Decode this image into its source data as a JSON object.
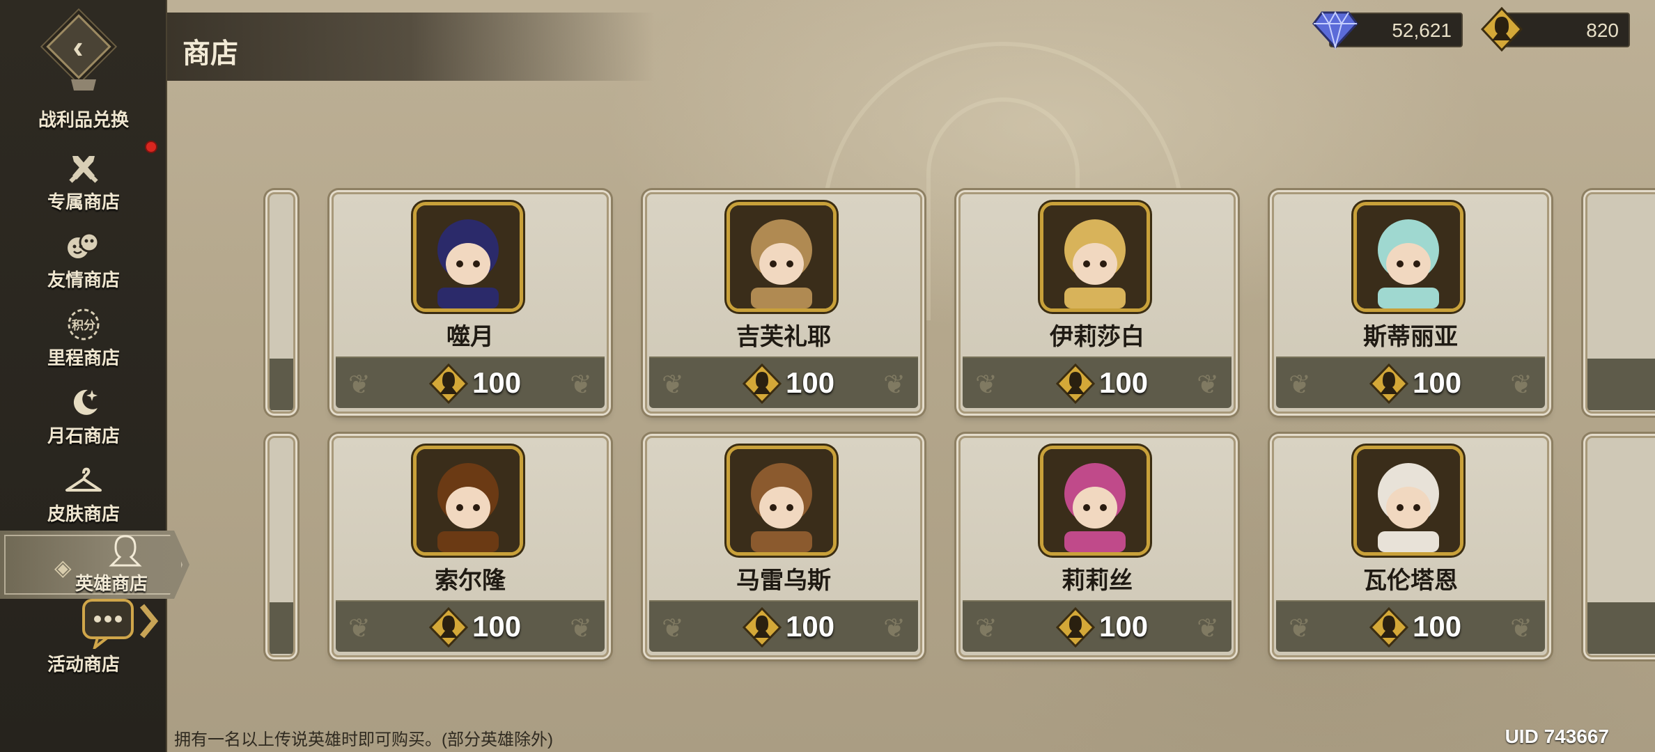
{
  "header": {
    "title": "商店"
  },
  "currencies": [
    {
      "name": "diamond",
      "value": "52,621",
      "icon": "diamond-icon"
    },
    {
      "name": "hero-token",
      "value": "820",
      "icon": "hero-token-icon"
    }
  ],
  "sidebar": {
    "items": [
      {
        "label": "战利品兑换",
        "icon": "loot-exchange-icon"
      },
      {
        "label": "专属商店",
        "icon": "crossed-swords-icon",
        "has_notification": true
      },
      {
        "label": "友情商店",
        "icon": "friendship-icon"
      },
      {
        "label": "里程商店",
        "icon": "mileage-points-icon",
        "icon_text": "积分"
      },
      {
        "label": "月石商店",
        "icon": "moon-icon"
      },
      {
        "label": "皮肤商店",
        "icon": "hanger-icon"
      },
      {
        "label": "英雄商店",
        "icon": "hero-icon",
        "active": true
      },
      {
        "label": "活动商店",
        "icon": "chat-icon"
      }
    ]
  },
  "heroes": [
    {
      "name": "噬月",
      "price": "100",
      "theme": "#2b2a6a"
    },
    {
      "name": "吉芙礼耶",
      "price": "100",
      "theme": "#b08a52"
    },
    {
      "name": "伊莉莎白",
      "price": "100",
      "theme": "#d8b35a"
    },
    {
      "name": "斯蒂丽亚",
      "price": "100",
      "theme": "#9fd8d0"
    },
    {
      "name": "索尔隆",
      "price": "100",
      "theme": "#6b3a14"
    },
    {
      "name": "马雷乌斯",
      "price": "100",
      "theme": "#8b5a2e"
    },
    {
      "name": "莉莉丝",
      "price": "100",
      "theme": "#c04a8a"
    },
    {
      "name": "瓦伦塔恩",
      "price": "100",
      "theme": "#e8e2d8"
    }
  ],
  "footer": {
    "note": "拥有一名以上传说英雄时即可购买。(部分英雄除外)",
    "uid": "UID 743667"
  }
}
